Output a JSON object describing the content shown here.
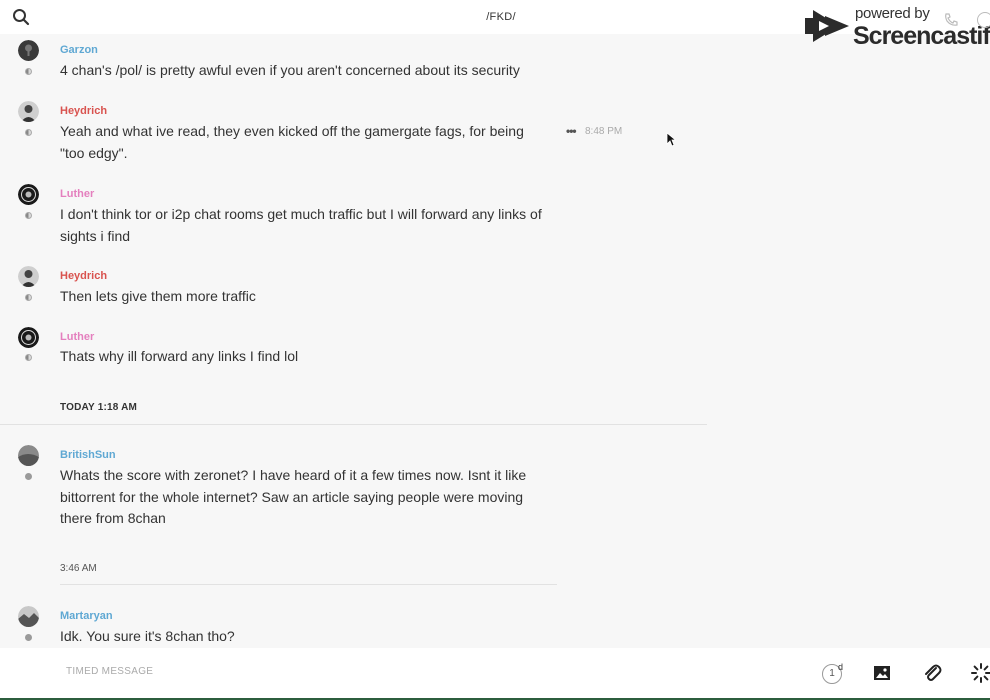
{
  "header": {
    "channel_title": "/FKD/"
  },
  "watermark": {
    "powered_by": "powered by",
    "brand": "Screencastify"
  },
  "messages": [
    {
      "author": "Garzon",
      "text": "4 chan's /pol/ is pretty awful even if you aren't concerned about its security"
    },
    {
      "author": "Heydrich",
      "text": "Yeah and what ive read, they even kicked off the gamergate fags, for being \"too edgy\".",
      "time": "8:48 PM"
    },
    {
      "author": "Luther",
      "text": "I don't think tor or i2p chat rooms get much traffic but I will forward any links of sights i find"
    },
    {
      "author": "Heydrich",
      "text": "Then lets give them more traffic"
    },
    {
      "author": "Luther",
      "text": "Thats why ill forward any links I find lol"
    },
    {
      "author": "BritishSun",
      "text": "Whats the score with zeronet?  I have heard of it a few times now.  Isnt it like bittorrent for the whole internet?  Saw an article saying people were moving there from 8chan"
    },
    {
      "author": "Martaryan",
      "text": "Idk. You sure it's 8chan tho?"
    }
  ],
  "separators": {
    "today": "TODAY 1:18 AM",
    "time_346": "3:46 AM"
  },
  "composer": {
    "placeholder": "TIMED MESSAGE",
    "timer_value": "1",
    "timer_unit": "d"
  }
}
